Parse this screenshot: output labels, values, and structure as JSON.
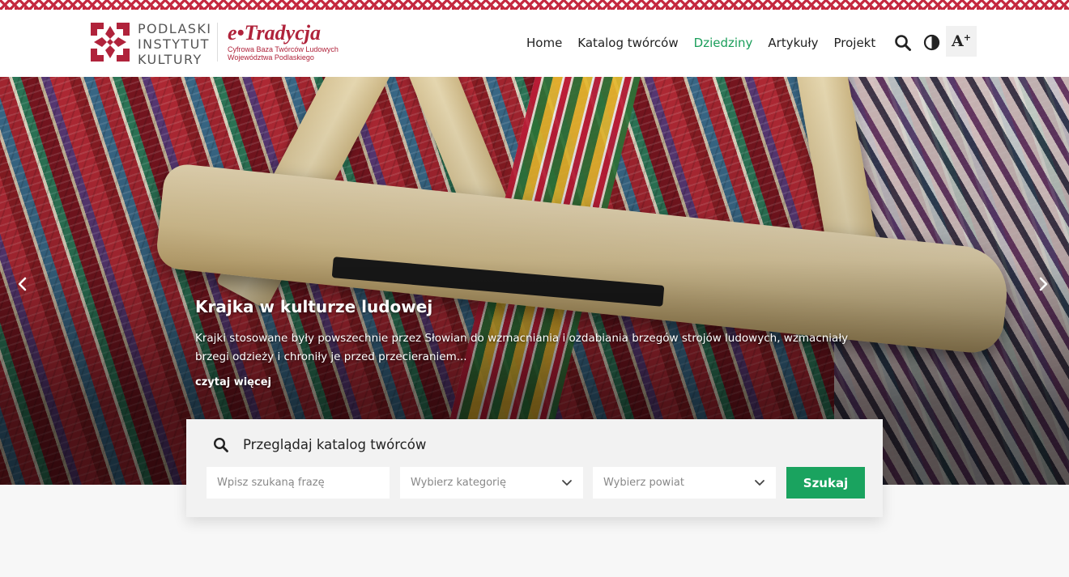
{
  "brand": {
    "institute_lines": [
      "PODLASKI",
      "INSTYTUT",
      "KULTURY"
    ],
    "product_title": "e•Tradycja",
    "product_subtitle_lines": [
      "Cyfrowa Baza Twórców Ludowych",
      "Województwa Podlaskiego"
    ],
    "accent_color": "#b0233b"
  },
  "nav": {
    "items": [
      {
        "label": "Home",
        "active": false
      },
      {
        "label": "Katalog twórców",
        "active": false
      },
      {
        "label": "Dziedziny",
        "active": true
      },
      {
        "label": "Artykuły",
        "active": false
      },
      {
        "label": "Projekt",
        "active": false
      }
    ],
    "active_color": "#1a9e5a"
  },
  "tools": {
    "search_icon": "search-icon",
    "contrast_icon": "contrast-icon",
    "font_size_label": "A",
    "font_size_sup": "+"
  },
  "hero": {
    "title": "Krajka w kulturze ludowej",
    "text": "Krajki stosowane były powszechnie przez Słowian do wzmacniania i ozdabiania brzegów strojów ludowych, wzmacniały brzegi odzieży i chroniły je przed przecieraniem...",
    "more_label": "czytaj więcej",
    "prev_icon": "chevron-left-icon",
    "next_icon": "chevron-right-icon"
  },
  "search": {
    "title": "Przeglądaj katalog twórców",
    "phrase_placeholder": "Wpisz szukaną frazę",
    "category_placeholder": "Wybierz kategorię",
    "district_placeholder": "Wybierz powiat",
    "submit_label": "Szukaj",
    "submit_color": "#1aa35f"
  }
}
